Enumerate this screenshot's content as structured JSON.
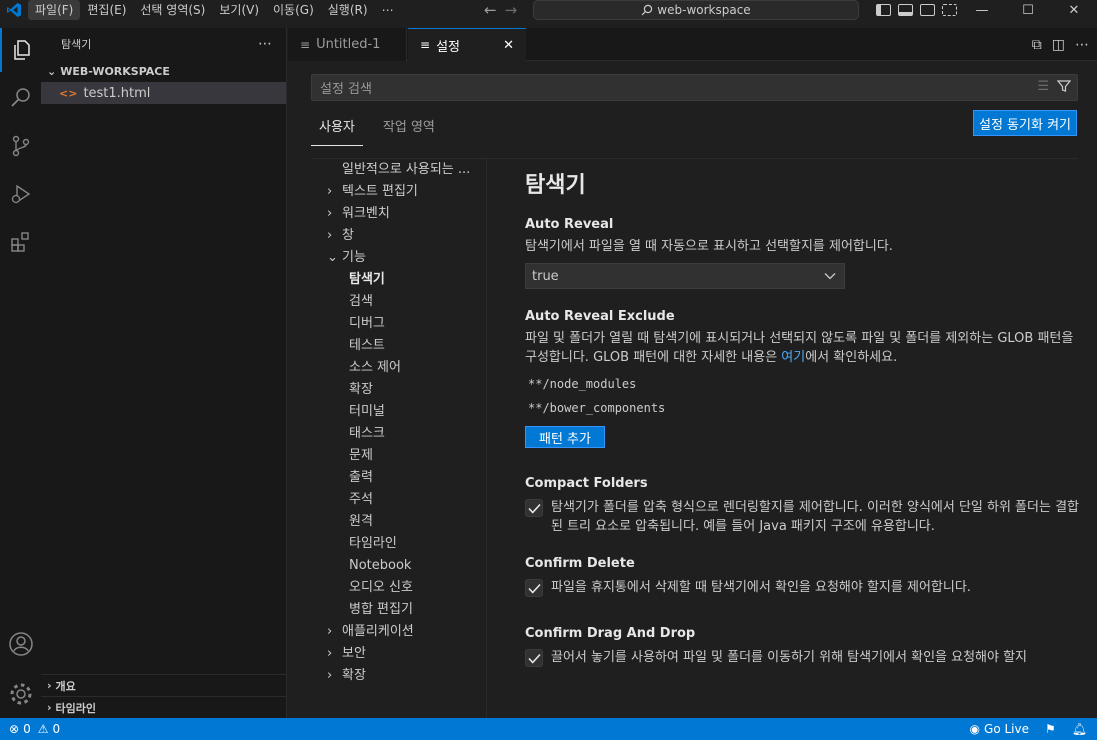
{
  "titlebar": {
    "menu": [
      "파일(F)",
      "편집(E)",
      "선택 영역(S)",
      "보기(V)",
      "이동(G)",
      "실행(R)",
      "⋯"
    ],
    "command_center": "web-workspace"
  },
  "sidebar": {
    "title": "탐색기",
    "more": "⋯",
    "workspace": "WEB-WORKSPACE",
    "file": "test1.html",
    "file_icon": "<>",
    "bottom_sections": [
      "개요",
      "타임라인"
    ]
  },
  "tabs": [
    {
      "label": "Untitled-1"
    },
    {
      "label": "설정",
      "close": "✕"
    }
  ],
  "settings": {
    "search_placeholder": "설정 검색",
    "scopes": [
      "사용자",
      "작업 영역"
    ],
    "sync_button": "설정 동기화 켜기",
    "toc": [
      {
        "label": "일반적으로 사용되는 ...",
        "chevron": ""
      },
      {
        "label": "텍스트 편집기",
        "chevron": "›"
      },
      {
        "label": "워크벤치",
        "chevron": "›"
      },
      {
        "label": "창",
        "chevron": "›"
      },
      {
        "label": "기능",
        "chevron": "⌄"
      },
      {
        "label": "탐색기",
        "sub": true,
        "active": true
      },
      {
        "label": "검색",
        "sub": true
      },
      {
        "label": "디버그",
        "sub": true
      },
      {
        "label": "테스트",
        "sub": true
      },
      {
        "label": "소스 제어",
        "sub": true
      },
      {
        "label": "확장",
        "sub": true
      },
      {
        "label": "터미널",
        "sub": true
      },
      {
        "label": "태스크",
        "sub": true
      },
      {
        "label": "문제",
        "sub": true
      },
      {
        "label": "출력",
        "sub": true
      },
      {
        "label": "주석",
        "sub": true
      },
      {
        "label": "원격",
        "sub": true
      },
      {
        "label": "타임라인",
        "sub": true
      },
      {
        "label": "Notebook",
        "sub": true
      },
      {
        "label": "오디오 신호",
        "sub": true
      },
      {
        "label": "병합 편집기",
        "sub": true
      },
      {
        "label": "애플리케이션",
        "chevron": "›"
      },
      {
        "label": "보안",
        "chevron": "›"
      },
      {
        "label": "확장",
        "chevron": "›"
      }
    ],
    "section_title": "탐색기",
    "auto_reveal": {
      "name": "Auto Reveal",
      "desc": "탐색기에서 파일을 열 때 자동으로 표시하고 선택할지를 제어합니다.",
      "value": "true"
    },
    "auto_reveal_exclude": {
      "name": "Auto Reveal Exclude",
      "desc_pre": "파일 및 폴더가 열릴 때 탐색기에 표시되거나 선택되지 않도록 파일 및 폴더를 제외하는 GLOB 패턴을 구성합니다. GLOB 패턴에 대한 자세한 내용은 ",
      "desc_link": "여기",
      "desc_post": "에서 확인하세요.",
      "patterns": [
        "**/node_modules",
        "**/bower_components"
      ],
      "add_button": "패턴 추가"
    },
    "compact_folders": {
      "name": "Compact Folders",
      "desc": "탐색기가 폴더를 압축 형식으로 렌더링할지를 제어합니다. 이러한 양식에서 단일 하위 폴더는 결합된 트리 요소로 압축됩니다. 예를 들어 Java 패키지 구조에 유용합니다."
    },
    "confirm_delete": {
      "name": "Confirm Delete",
      "desc": "파일을 휴지통에서 삭제할 때 탐색기에서 확인을 요청해야 할지를 제어합니다."
    },
    "confirm_dnd": {
      "name": "Confirm Drag And Drop",
      "desc": "끌어서 놓기를 사용하여 파일 및 폴더를 이동하기 위해 탐색기에서 확인을 요청해야 할지"
    }
  },
  "statusbar": {
    "errors": "0",
    "warnings": "0",
    "go_live": "Go Live"
  },
  "colors": {
    "accent": "#0078d4",
    "link": "#4daafc"
  }
}
